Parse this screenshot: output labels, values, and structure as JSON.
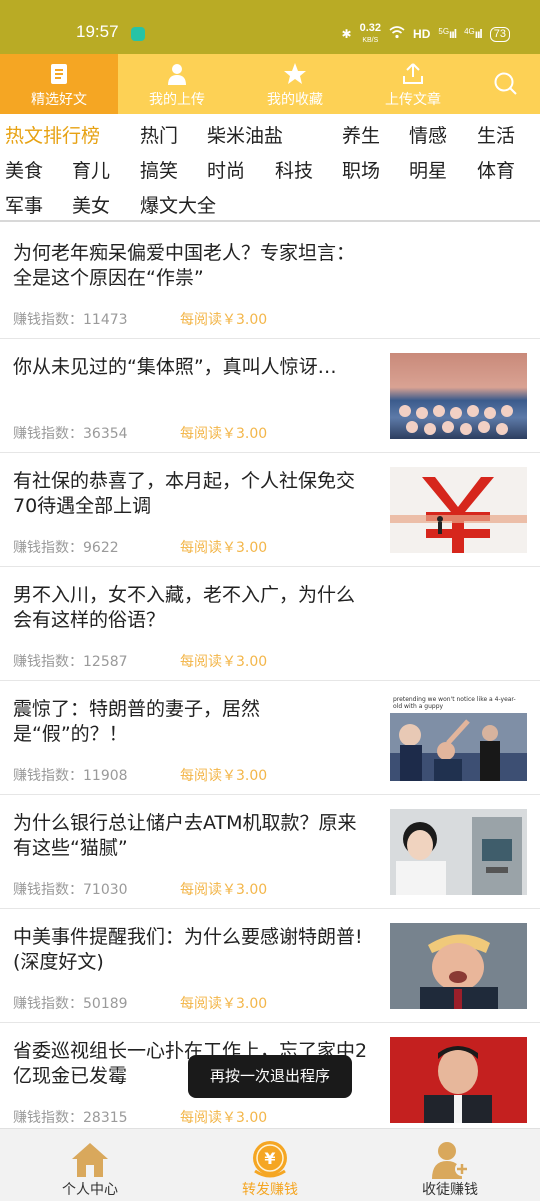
{
  "status_bar": {
    "time": "19:57",
    "network_speed": "0.32",
    "speed_unit": "KB/S",
    "hd_label": "HD",
    "signal_1": "5G",
    "signal_2": "4G",
    "battery": "73"
  },
  "top_nav": {
    "tabs": [
      {
        "label": "精选好文",
        "icon": "document-icon",
        "active": true
      },
      {
        "label": "我的上传",
        "icon": "person-icon",
        "active": false
      },
      {
        "label": "我的收藏",
        "icon": "star-icon",
        "active": false
      },
      {
        "label": "上传文章",
        "icon": "upload-icon",
        "active": false
      }
    ],
    "search_icon": "search-icon",
    "colors": {
      "bar": "#fdd155",
      "active": "#f5a623"
    }
  },
  "categories": [
    "热文排行榜",
    "热门",
    "柴米油盐",
    "养生",
    "情感",
    "生活",
    "美食",
    "育儿",
    "搞笑",
    "时尚",
    "科技",
    "职场",
    "明星",
    "体育",
    "军事",
    "美女",
    "爆文大全"
  ],
  "articles": [
    {
      "title": "为何老年痴呆偏爱中国老人？专家坦言：全是这个原因在“作祟”",
      "index_label": "赚钱指数：",
      "index_value": "11473",
      "reward": "每阅读￥3.00",
      "has_image": false
    },
    {
      "title": "你从未见过的“集体照”，真叫人惊讶…",
      "index_label": "赚钱指数：",
      "index_value": "36354",
      "reward": "每阅读￥3.00",
      "has_image": true
    },
    {
      "title": "有社保的恭喜了，本月起，个人社保免交70待遇全部上调",
      "index_label": "赚钱指数：",
      "index_value": "9622",
      "reward": "每阅读￥3.00",
      "has_image": true
    },
    {
      "title": "男不入川，女不入藏，老不入广，为什么会有这样的俗语？",
      "index_label": "赚钱指数：",
      "index_value": "12587",
      "reward": "每阅读￥3.00",
      "has_image": false
    },
    {
      "title": "震惊了：特朗普的妻子，居然是“假”的？！",
      "index_label": "赚钱指数：",
      "index_value": "11908",
      "reward": "每阅读￥3.00",
      "has_image": true,
      "image_caption": "pretending we won't notice like a 4-year-old with a guppy"
    },
    {
      "title": "为什么银行总让储户去ATM机取款？原来有这些“猫腻”",
      "index_label": "赚钱指数：",
      "index_value": "71030",
      "reward": "每阅读￥3.00",
      "has_image": true
    },
    {
      "title": "中美事件提醒我们：为什么要感谢特朗普!(深度好文)",
      "index_label": "赚钱指数：",
      "index_value": "50189",
      "reward": "每阅读￥3.00",
      "has_image": true
    },
    {
      "title": "省委巡视组长一心扑在工作上，忘了家中2亿现金已发霉",
      "index_label": "赚钱指数：",
      "index_value": "28315",
      "reward": "每阅读￥3.00",
      "has_image": true
    }
  ],
  "toast": "再按一次退出程序",
  "bottom_nav": [
    {
      "label": "个人中心",
      "icon": "home-icon",
      "active": false
    },
    {
      "label": "转发赚钱",
      "icon": "yen-coin-icon",
      "active": true
    },
    {
      "label": "收徒赚钱",
      "icon": "user-plus-icon",
      "active": false
    }
  ]
}
